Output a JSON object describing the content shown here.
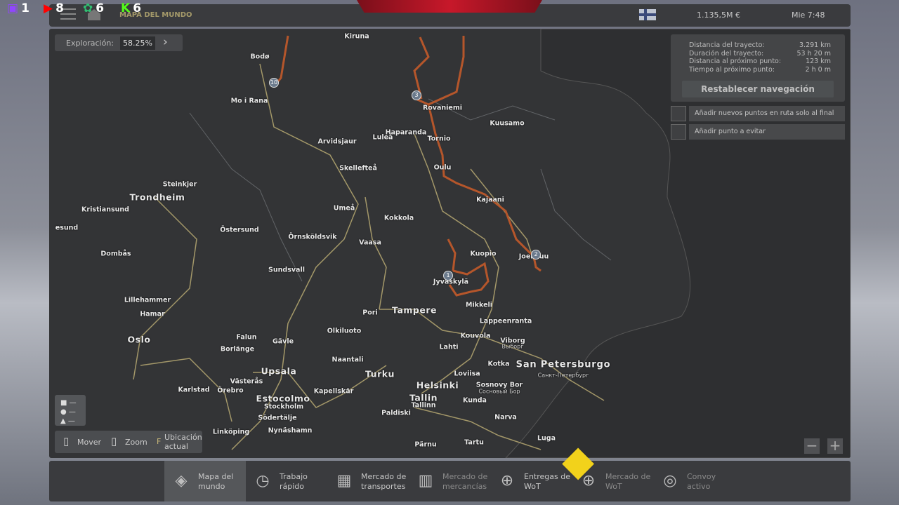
{
  "overlay": {
    "twitch": "1",
    "youtube": "8",
    "green": "6",
    "kick": "6"
  },
  "header": {
    "breadcrumb": "MAPA DEL MUNDO",
    "money": "1.135,5M €",
    "clock": "Mie 7:48"
  },
  "exploration": {
    "label": "Exploración:",
    "value": "58.25%"
  },
  "route_info": {
    "rows": [
      {
        "label": "Distancia del trayecto:",
        "value": "3.291 km"
      },
      {
        "label": "Duración del trayecto:",
        "value": "53 h 20 m"
      },
      {
        "label": "Distancia al próximo punto:",
        "value": "123 km"
      },
      {
        "label": "Tiempo al próximo punto:",
        "value": "2 h 0 m"
      }
    ],
    "reset_button": "Restablecer navegación"
  },
  "options": [
    {
      "label": "Añadir nuevos puntos en ruta solo al final"
    },
    {
      "label": "Añadir punto a evitar"
    }
  ],
  "controls": {
    "move": "Mover",
    "zoom": "Zoom",
    "location": "Ubicación actual"
  },
  "waypoints": [
    "10",
    "3",
    "2",
    "1"
  ],
  "cities": [
    "Kiruna",
    "Bodø",
    "Mo i Rana",
    "Rovaniemi",
    "Kuusamo",
    "Haparanda",
    "Luleå",
    "Tornio",
    "Arvidsjaur",
    "Skellefteå",
    "Oulu",
    "Steinkjer",
    "Trondheim",
    "Kajaani",
    "Kristiansund",
    "Umeå",
    "Kokkola",
    "Östersund",
    "Örnsköldsvik",
    "Vaasa",
    "Kuopio",
    "Joensuu",
    "Dombås",
    "Sundsvall",
    "Jyväskylä",
    "Lillehammer",
    "Mikkeli",
    "Tampere",
    "Pori",
    "Hamar",
    "Lappeenranta",
    "Olkiluoto",
    "Kouvola",
    "Oslo",
    "Falun",
    "Gävle",
    "Viborg",
    "Выборг",
    "Lahti",
    "Borlänge",
    "Naantali",
    "Kotka",
    "San Petersburgo",
    "Санкт-Петербург",
    "Turku",
    "Upsala",
    "Loviisa",
    "Helsinki",
    "Västerås",
    "Sosnovy Bor",
    "Сосновый Бор",
    "Karlstad",
    "Örebro",
    "Kapellskär",
    "Estocolmo",
    "Kunda",
    "Tallin",
    "Tallinn",
    "Stockholm",
    "Paldiski",
    "Södertälje",
    "Narva",
    "Linköping",
    "Nynäshamn",
    "Luga",
    "Tartu",
    "Pärnu",
    "esund"
  ],
  "tabs": [
    {
      "label": "Mapa del mundo",
      "icon": "map-icon",
      "active": true
    },
    {
      "label": "Trabajo rápido",
      "icon": "clock-icon"
    },
    {
      "label": "Mercado de transportes",
      "icon": "freight-icon"
    },
    {
      "label": "Mercado de mercancías",
      "icon": "cargo-icon",
      "dim": true
    },
    {
      "label": "Entregas de WoT",
      "icon": "globe-icon"
    },
    {
      "label": "Mercado de WoT",
      "icon": "globe-market-icon",
      "dim": true
    },
    {
      "label": "Convoy activo",
      "icon": "convoy-icon",
      "dim": true
    }
  ],
  "colors": {
    "route": "#b5562b",
    "road": "#c9b97a",
    "accent": "#a59a6a"
  }
}
